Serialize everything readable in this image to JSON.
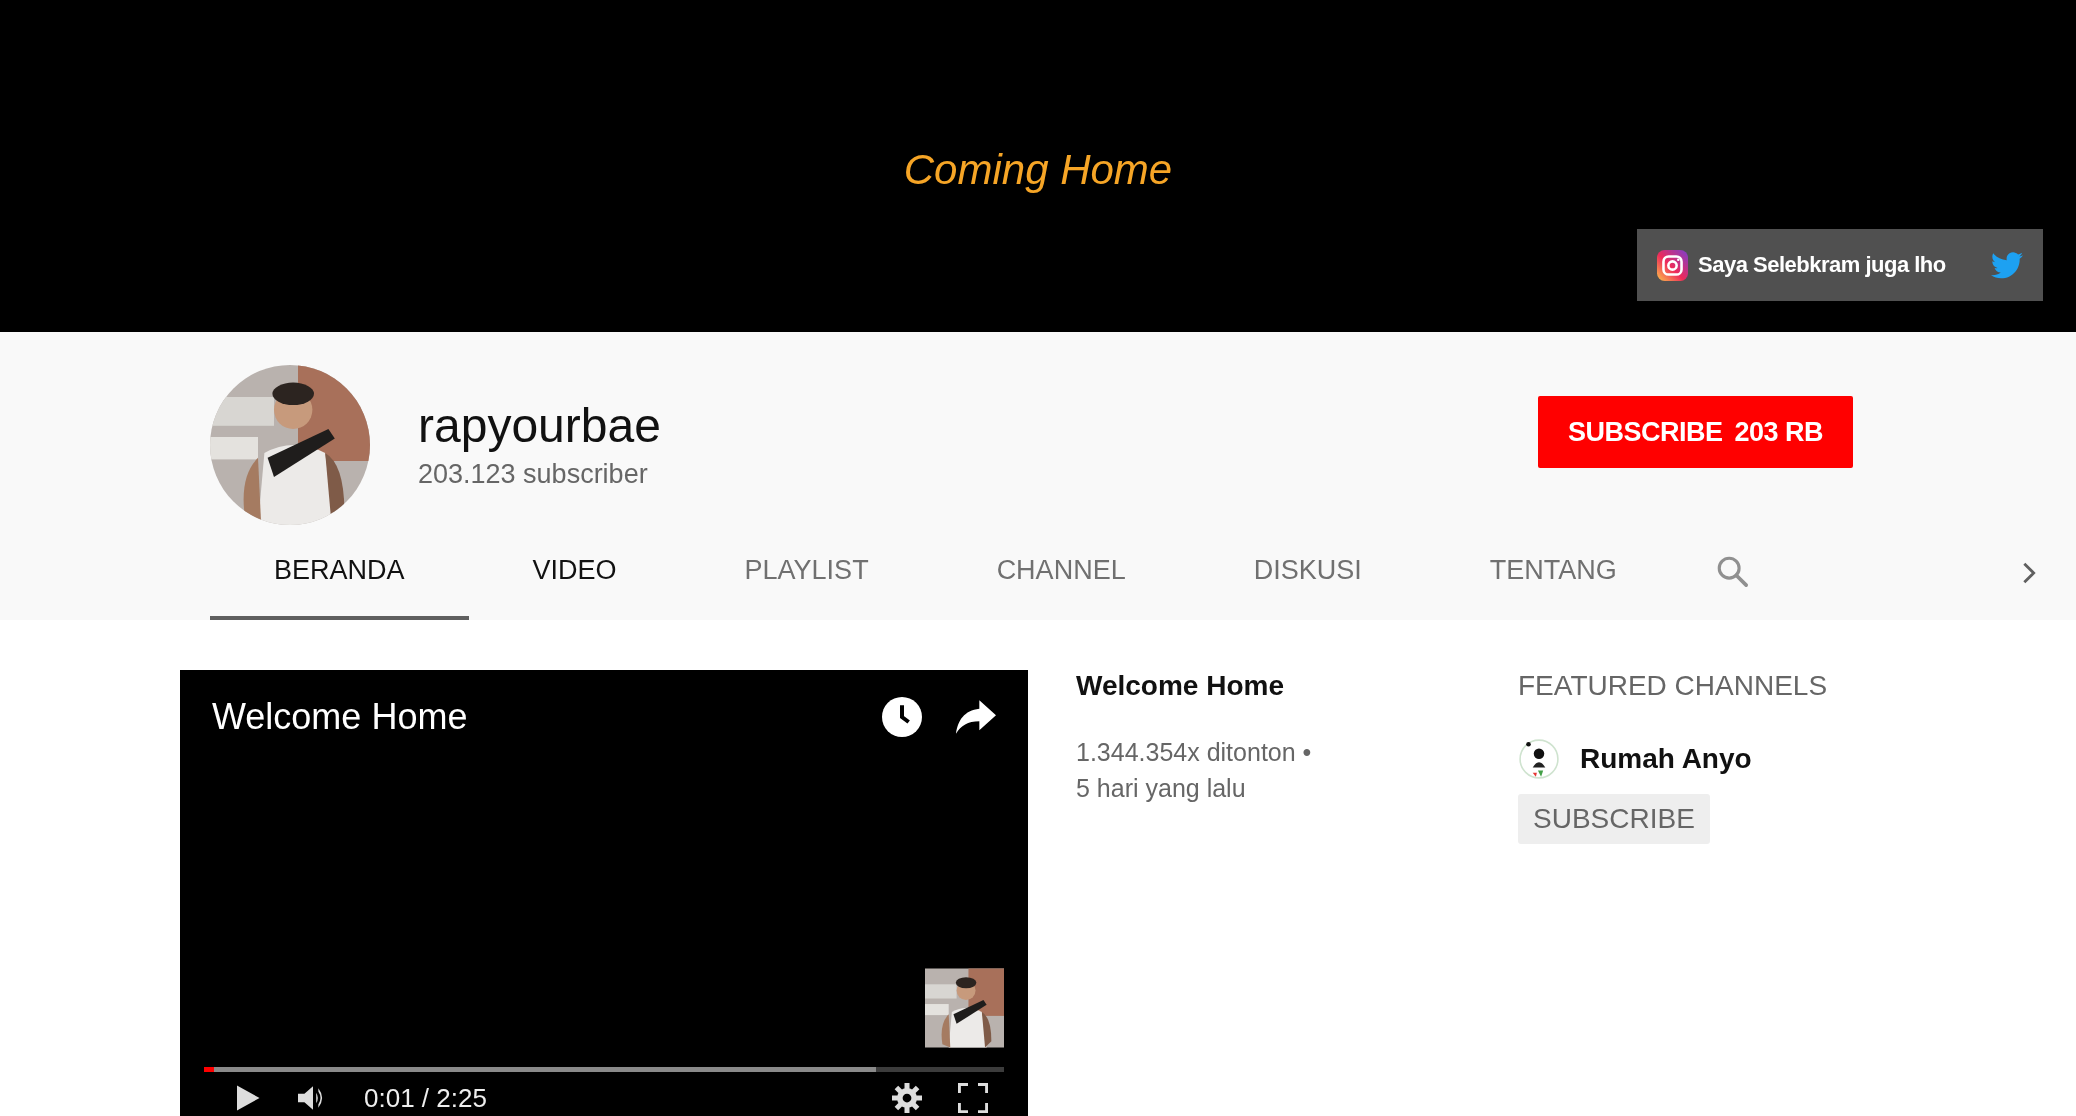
{
  "banner": {
    "title": "Coming Home",
    "link": {
      "text": "Saya Selebkram juga lho"
    }
  },
  "channel": {
    "name": "rapyourbae",
    "subscribers": "203.123 subscriber",
    "subscribe_button": {
      "label": "SUBSCRIBE",
      "count": "203 RB"
    }
  },
  "tabs": [
    {
      "label": "BERANDA",
      "selected": true,
      "hovered": false
    },
    {
      "label": "VIDEO",
      "selected": false,
      "hovered": true
    },
    {
      "label": "PLAYLIST",
      "selected": false,
      "hovered": false
    },
    {
      "label": "CHANNEL",
      "selected": false,
      "hovered": false
    },
    {
      "label": "DISKUSI",
      "selected": false,
      "hovered": false
    },
    {
      "label": "TENTANG",
      "selected": false,
      "hovered": false
    }
  ],
  "featured_video": {
    "player": {
      "title": "Welcome Home",
      "played": {
        "level": 0.0125
      },
      "buffered": {
        "level": 0.84
      },
      "time": "0:01 / 2:25"
    },
    "title": "Welcome Home",
    "views": "1.344.354x ditonton •",
    "age": "5 hari yang lalu"
  },
  "featured_channels": {
    "heading": "FEATURED CHANNELS",
    "channels": [
      {
        "name": "Rumah Anyo",
        "button": "SUBSCRIBE"
      }
    ]
  }
}
